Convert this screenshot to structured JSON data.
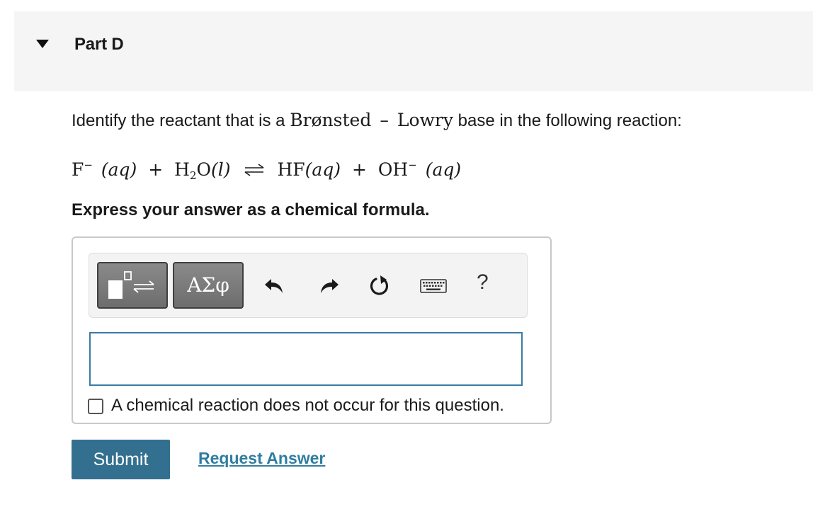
{
  "part": {
    "title": "Part D"
  },
  "question": {
    "prefix": "Identify the reactant that is a ",
    "term_1": "Brønsted",
    "dash": "–",
    "term_2": "Lowry",
    "suffix": " base in the following reaction:"
  },
  "equation": {
    "r1": "F",
    "r1_charge": "−",
    "r1_state": "(aq)",
    "plus_1": "+",
    "r2_a": "H",
    "r2_sub": "2",
    "r2_b": "O",
    "r2_state": "(l)",
    "p1": "HF",
    "p1_state": "(aq)",
    "plus_2": "+",
    "p2": "OH",
    "p2_charge": "−",
    "p2_state": "(aq)"
  },
  "instruction": "Express your answer as a chemical formula.",
  "toolbar": {
    "greek_label": "ΑΣφ",
    "help_label": "?"
  },
  "answer": {
    "value": "",
    "placeholder": ""
  },
  "no_reaction_checkbox": {
    "label": "A chemical reaction does not occur for this question.",
    "checked": false
  },
  "actions": {
    "submit_label": "Submit",
    "request_answer_label": "Request Answer"
  },
  "colors": {
    "header_bg": "#f5f5f5",
    "submit_bg": "#33708f",
    "link": "#2f7da0",
    "input_border": "#3a7ca5"
  }
}
